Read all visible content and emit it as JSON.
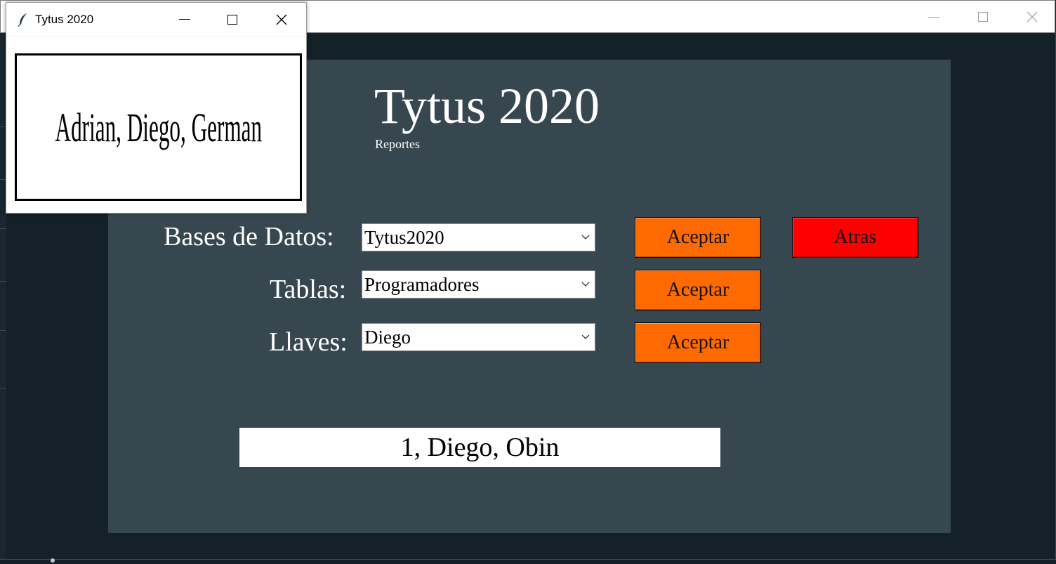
{
  "popup": {
    "title": "Tytus 2020",
    "names": "Adrian, Diego, German"
  },
  "app": {
    "title": "Tytus 2020",
    "subtitle": "Reportes"
  },
  "form": {
    "databases_label": "Bases de Datos:",
    "tables_label": "Tablas:",
    "keys_label": "Llaves:",
    "database_value": "Tytus2020",
    "table_value": "Programadores",
    "key_value": "Diego",
    "accept_label": "Aceptar",
    "back_label": "Atras"
  },
  "result": "1, Diego, Obin",
  "colors": {
    "panel": "#37474f",
    "window_bg": "#152129",
    "accept_button": "#ff6a00",
    "back_button": "#ff0000"
  },
  "icons": {
    "window_icon": "feather-icon",
    "minimize": "minimize-icon",
    "maximize": "maximize-icon",
    "close": "close-icon",
    "dropdown": "chevron-down-icon"
  }
}
